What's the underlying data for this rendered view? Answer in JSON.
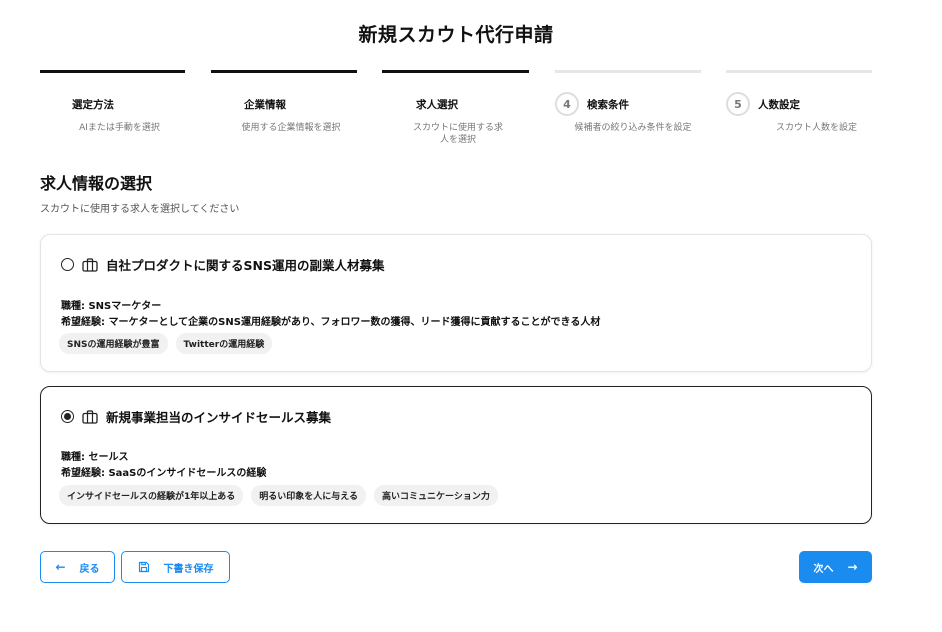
{
  "page": {
    "title": "新規スカウト代行申請"
  },
  "steps": [
    {
      "number": "",
      "label": "選定方法",
      "description": "AIまたは手動を選択"
    },
    {
      "number": "",
      "label": "企業情報",
      "description": "使用する企業情報を選択"
    },
    {
      "number": "",
      "label": "求人選択",
      "description": "スカウトに使用する求人を選択"
    },
    {
      "number": "4",
      "label": "検索条件",
      "description": "候補者の絞り込み条件を設定"
    },
    {
      "number": "5",
      "label": "人数設定",
      "description": "スカウト人数を設定"
    }
  ],
  "section": {
    "title": "求人情報の選択",
    "subtitle": "スカウトに使用する求人を選択してください"
  },
  "jobs": [
    {
      "title": "自社プロダクトに関するSNS運用の副業人材募集",
      "role": "職種: SNSマーケター",
      "experience": "希望経験: マーケターとして企業のSNS運用経験があり、フォロワー数の獲得、リード獲得に貢献することができる人材",
      "tags": [
        "SNSの運用経験が豊富",
        "Twitterの運用経験"
      ],
      "selected": false
    },
    {
      "title": "新規事業担当のインサイドセールス募集",
      "role": "職種: セールス",
      "experience": "希望経験: SaaSのインサイドセールスの経験",
      "tags": [
        "インサイドセールスの経験が1年以上ある",
        "明るい印象を人に与える",
        "高いコミュニケーション力"
      ],
      "selected": true
    }
  ],
  "footer": {
    "back_label": "戻る",
    "save_label": "下書き保存",
    "next_label": "次へ"
  },
  "colors": {
    "accent": "#1a8cf0",
    "done_bar": "#111111",
    "pending_bar": "#e6e6e6"
  },
  "icons": {
    "job": "briefcase-icon",
    "back": "arrow-left-icon",
    "save": "floppy-disk-icon",
    "next": "arrow-right-icon"
  }
}
